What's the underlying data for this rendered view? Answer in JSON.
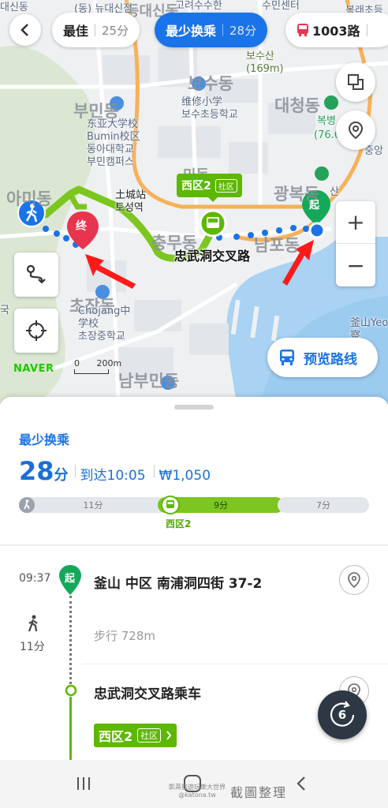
{
  "top_bar": {
    "options": [
      {
        "label": "最佳",
        "time": "25分"
      },
      {
        "label": "最少换乘",
        "time": "28分"
      },
      {
        "label": "1003路",
        "time": ""
      }
    ]
  },
  "map": {
    "district_labels": [
      "아미동",
      "부민동",
      "충무동",
      "남포동",
      "광복동",
      "대청동",
      "보수동",
      "초장동",
      "남부민동"
    ],
    "partial_labels": [
      "대신동",
      "동대신동",
      "수민센터",
      "복래초등",
      "(동) 뉴대신점",
      "복병",
      "(76.6",
      "중앙",
      "민동",
      "산",
      "국"
    ],
    "landmarks": [
      {
        "text": "东亚大学校\nBumin校区\n동아대학교\n부민캠퍼스"
      },
      {
        "text": "维修小学\n보수초등학교"
      },
      {
        "text": "土城站\n토성역"
      },
      {
        "text": "Chojang中\n学校\n초장중학교"
      },
      {
        "text": "보수산\n(169m)"
      },
      {
        "text": "釜山Yeo\n察\n부산"
      },
      {
        "text": "고려수수한"
      }
    ],
    "bus_bubble": {
      "name": "西区2",
      "tag": "社区"
    },
    "stop_label": "忠武洞交叉路",
    "start_pin": "起",
    "end_pin": "终",
    "scale_label": "200m",
    "scale_zero": "0",
    "naver_logo": "NAVER",
    "preview_button": "预览路线",
    "zoom_in": "+",
    "zoom_out": "−"
  },
  "sheet": {
    "route_type": "最少换乘",
    "total_time_value": "28",
    "total_time_unit": "分",
    "arrival": "到达10:05",
    "fare": "₩1,050",
    "segments": [
      {
        "mode": "walk",
        "label": "11分",
        "fraction": 0.393
      },
      {
        "mode": "bus",
        "label": "9分",
        "fraction": 0.321
      },
      {
        "mode": "walk",
        "label": "7分",
        "fraction": 0.25
      }
    ],
    "segment_bus_name": "西区2",
    "steps": [
      {
        "time": "09:37",
        "pin": "起",
        "title": "釜山 中区 南浦洞四街 37-2"
      },
      {
        "walk_label": "步行 728m",
        "walk_duration": "11分"
      },
      {
        "title": "忠武洞交叉路乘车",
        "bus_name": "西区2",
        "bus_tag": "社区"
      }
    ],
    "timer_value": "6"
  },
  "watermark": {
    "text": "截圖整理",
    "small_line1": "凱蒂旅遊玩樂大世界",
    "small_line2": "@katona.tw"
  },
  "colors": {
    "accent": "#1a73e8",
    "bus_green": "#5cb800",
    "end_red": "#e8344e",
    "start_green": "#14a85a"
  }
}
